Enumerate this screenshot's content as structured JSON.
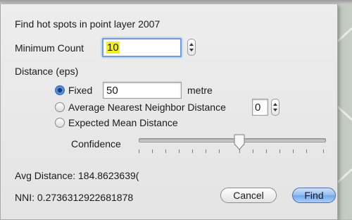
{
  "dialog": {
    "heading": "Find hot spots in point layer 2007",
    "min_count_label": "Minimum Count",
    "min_count_value": "10",
    "distance_label": "Distance (eps)",
    "options": {
      "fixed_label": "Fixed",
      "fixed_value": "50",
      "fixed_unit": "metre",
      "ann_label": "Average Nearest Neighbor Distance",
      "ann_value": "0",
      "emd_label": "Expected Mean Distance",
      "selected": "Fixed"
    },
    "confidence_label": "Confidence",
    "avg_distance": "Avg Distance: 184.8623639(",
    "nni": "NNI: 0.2736312922681878",
    "cancel_label": "Cancel",
    "find_label": "Find"
  },
  "colors": {
    "highlight": "#f3f01f",
    "default_button": "#72a8ee",
    "radio_selected": "#3b77cd"
  }
}
